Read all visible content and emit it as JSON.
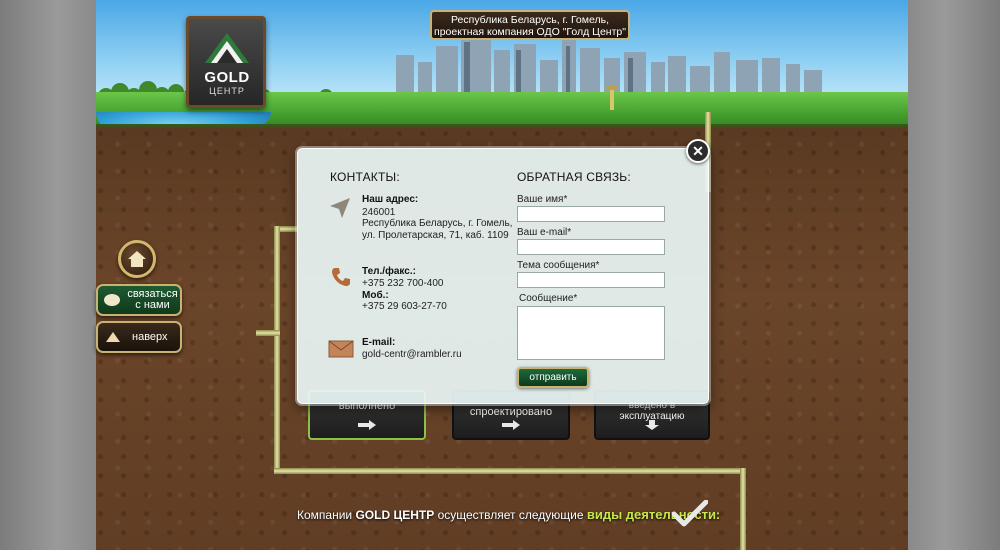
{
  "header": {
    "logo_title": "GOLD",
    "logo_subtitle": "ЦЕНТР",
    "location_line1": "Республика Беларусь, г. Гомель,",
    "location_line2": "проектная компания ОДО \"Голд Центр\""
  },
  "side_nav": {
    "contact_label_line1": "связаться",
    "contact_label_line2": "с нами",
    "up_label": "наверх"
  },
  "stats": [
    {
      "label": "выполнено"
    },
    {
      "label": "спроектировано"
    },
    {
      "label": "введено в эксплуатацию"
    }
  ],
  "footer": {
    "prefix": "Компании ",
    "brand": "GOLD ЦЕНТР",
    "middle": " осуществляет следующие ",
    "highlight": "виды деятельности:"
  },
  "modal": {
    "contacts_heading": "КОНТАКТЫ:",
    "feedback_heading": "ОБРАТНАЯ СВЯЗЬ:",
    "address_label": "Наш адрес:",
    "address_line1": "246001",
    "address_line2": "Республика Беларусь, г. Гомель,",
    "address_line3": "ул. Пролетарская, 71, каб. 1109",
    "phone_label": "Тел./факс.:",
    "phone_value": "+375 232 700-400",
    "mobile_label": "Моб.:",
    "mobile_value": "+375 29 603-27-70",
    "email_label": "E-mail:",
    "email_value": "gold-centr@rambler.ru",
    "form": {
      "name_label": "Ваше имя*",
      "email_label": "Ваш e-mail*",
      "subject_label": "Тема сообщения*",
      "message_label": "Сообщение*",
      "name_value": "",
      "email_value": "",
      "subject_value": "",
      "message_value": "",
      "submit_label": "отправить"
    }
  },
  "colors": {
    "soil": "#6b4529",
    "grass": "#3f9a2c",
    "modal_bg": "#e8f5f4",
    "accent_green": "#1e6a3c",
    "gold_border": "#c8b372"
  }
}
